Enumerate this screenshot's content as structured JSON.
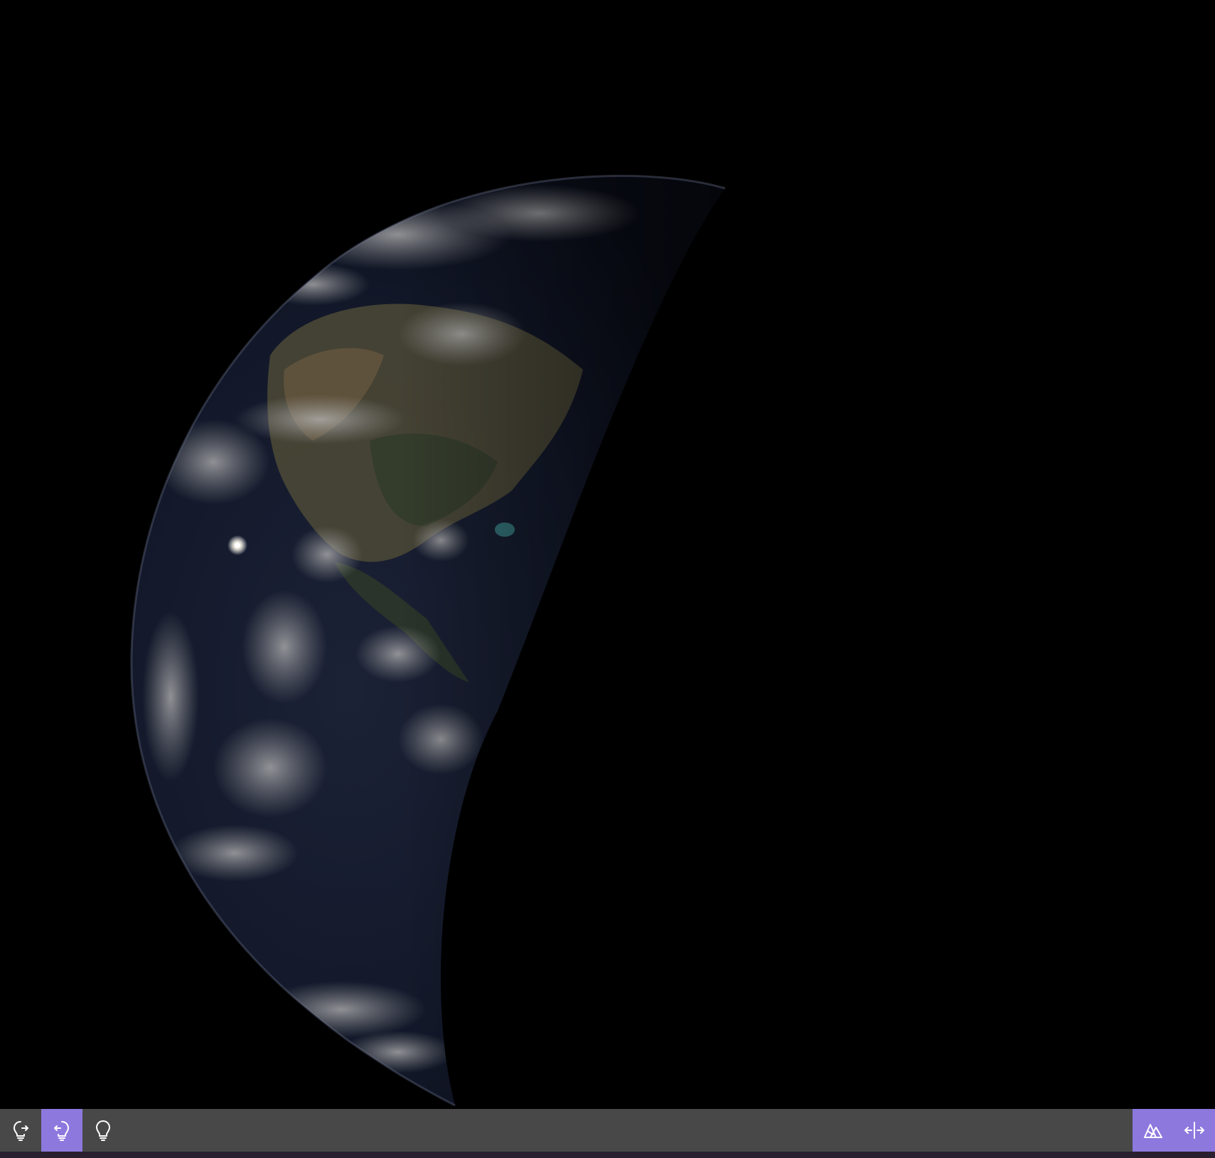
{
  "scene": {
    "background": "#000000",
    "subject": "earth-globe",
    "lit_side": "left",
    "sun_glint": true
  },
  "toolbar": {
    "background": "#484848",
    "active_color": "#8d78de",
    "left_buttons": [
      {
        "name": "light-from-right-icon",
        "active": false
      },
      {
        "name": "light-from-left-icon",
        "active": true
      },
      {
        "name": "light-bulb-icon",
        "active": false
      }
    ],
    "right_buttons": [
      {
        "name": "terrain-layers-icon",
        "active": true
      },
      {
        "name": "split-view-icon",
        "active": true
      }
    ]
  }
}
